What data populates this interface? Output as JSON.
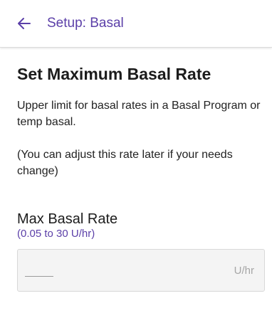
{
  "header": {
    "back_icon": "arrow-left-icon",
    "title": "Setup: Basal",
    "accent_color": "#5b3fa8"
  },
  "main": {
    "heading": "Set Maximum Basal Rate",
    "description": "Upper limit for basal rates in a Basal Program or temp basal.",
    "note": "(You can adjust this rate later if your needs change)",
    "field": {
      "label": "Max Basal Rate",
      "range": "(0.05 to 30 U/hr)",
      "placeholder": "—",
      "unit": "U/hr"
    }
  }
}
